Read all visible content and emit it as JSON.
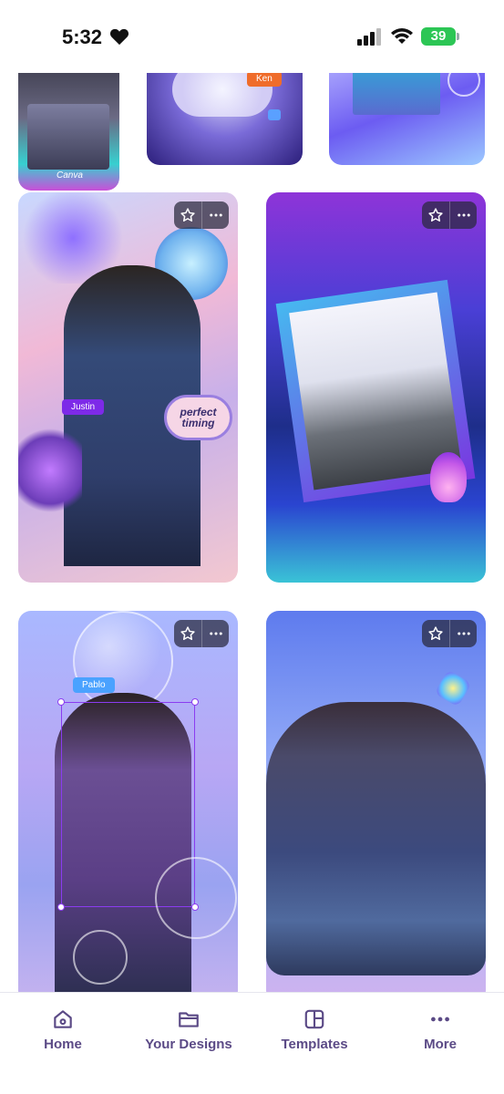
{
  "status_bar": {
    "time": "5:32",
    "battery": "39"
  },
  "cards": [
    {
      "tag": "Ken"
    },
    {
      "tag": "Justin",
      "sticker": "perfect timing"
    },
    {
      "tag": "Pablo"
    },
    {
      "tag": ""
    }
  ],
  "card_watermark": "Canva",
  "nav": {
    "items": [
      {
        "label": "Home",
        "icon": "home-icon"
      },
      {
        "label": "Your Designs",
        "icon": "folder-icon"
      },
      {
        "label": "Templates",
        "icon": "templates-icon"
      },
      {
        "label": "More",
        "icon": "more-icon"
      }
    ]
  },
  "colors": {
    "accent": "#7d2ae8",
    "nav_text": "#5b4a86"
  }
}
